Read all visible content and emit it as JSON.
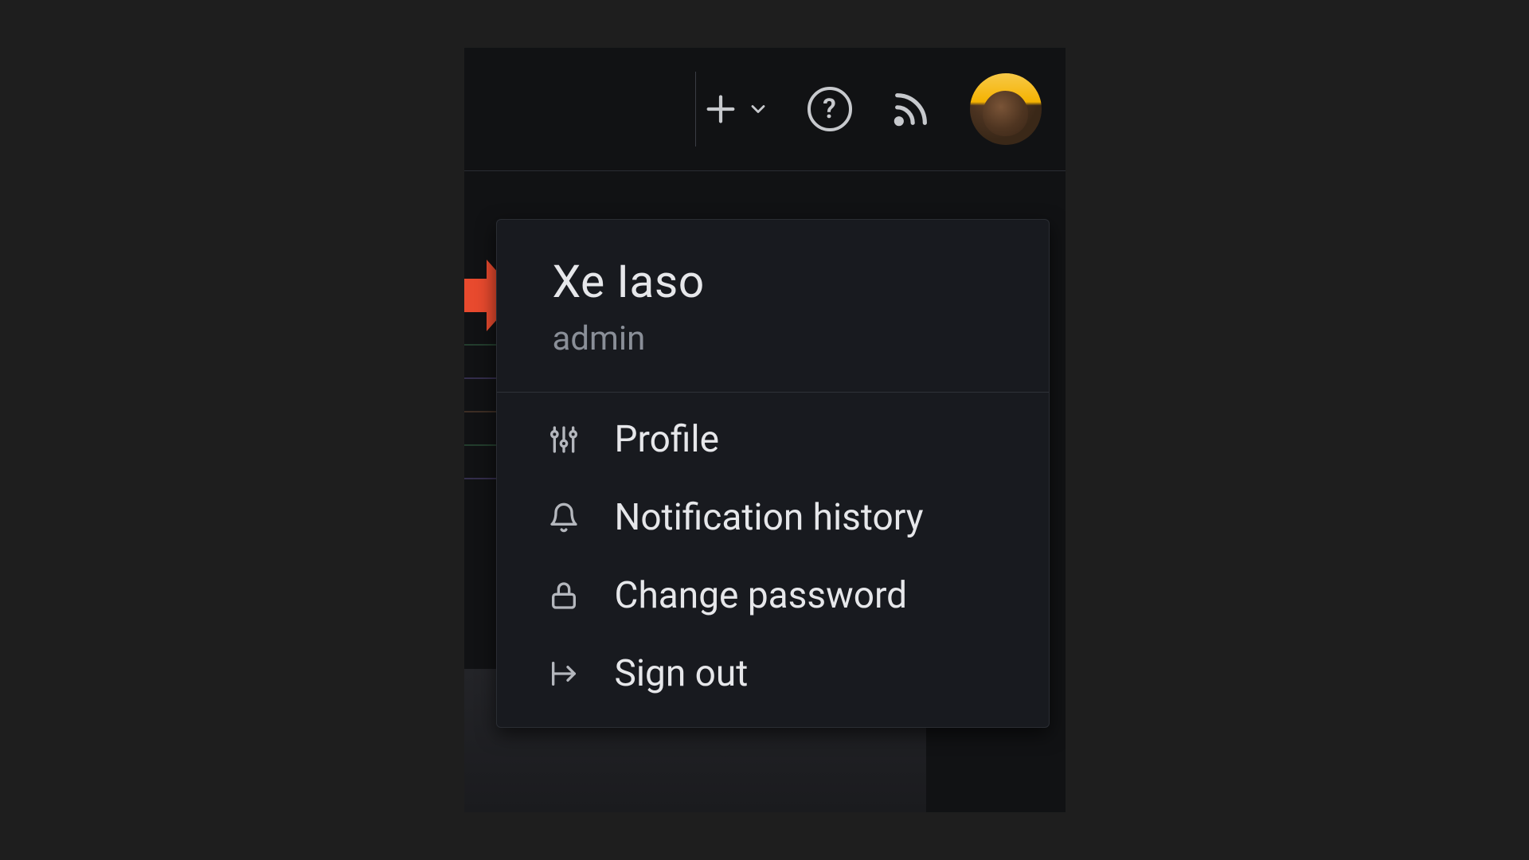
{
  "user": {
    "display_name": "Xe Iaso",
    "role": "admin"
  },
  "menu": {
    "items": [
      {
        "icon": "sliders-icon",
        "label": "Profile"
      },
      {
        "icon": "bell-icon",
        "label": "Notification history"
      },
      {
        "icon": "lock-icon",
        "label": "Change password"
      },
      {
        "icon": "signout-icon",
        "label": "Sign out"
      }
    ]
  }
}
